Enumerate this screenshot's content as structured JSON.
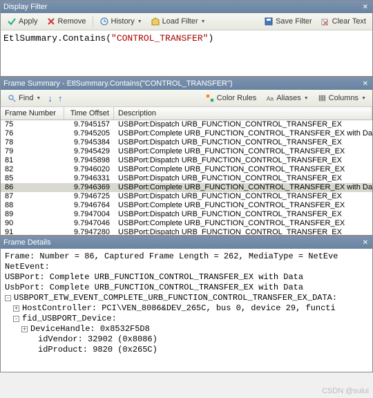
{
  "displayFilter": {
    "title": "Display Filter",
    "toolbar": {
      "apply": "Apply",
      "remove": "Remove",
      "history": "History",
      "loadFilter": "Load Filter",
      "saveFilter": "Save Filter",
      "clearText": "Clear Text"
    },
    "expression": {
      "func": "EtlSummary.Contains(",
      "str": "\"CONTROL_TRANSFER\"",
      "close": ")"
    }
  },
  "frameSummary": {
    "title": "Frame Summary - EtlSummary.Contains(\"CONTROL_TRANSFER\")",
    "toolbar": {
      "find": "Find",
      "colorRules": "Color Rules",
      "aliases": "Aliases",
      "columns": "Columns"
    },
    "columns": {
      "num": "Frame Number",
      "time": "Time Offset",
      "desc": "Description"
    },
    "rows": [
      {
        "num": "75",
        "time": "9.7945157",
        "desc": "USBPort:Dispatch URB_FUNCTION_CONTROL_TRANSFER_EX",
        "sel": false
      },
      {
        "num": "76",
        "time": "9.7945205",
        "desc": "USBPort:Complete URB_FUNCTION_CONTROL_TRANSFER_EX with Data",
        "sel": false
      },
      {
        "num": "78",
        "time": "9.7945384",
        "desc": "USBPort:Dispatch URB_FUNCTION_CONTROL_TRANSFER_EX",
        "sel": false
      },
      {
        "num": "79",
        "time": "9.7945429",
        "desc": "USBPort:Complete URB_FUNCTION_CONTROL_TRANSFER_EX",
        "sel": false
      },
      {
        "num": "81",
        "time": "9.7945898",
        "desc": "USBPort:Dispatch URB_FUNCTION_CONTROL_TRANSFER_EX",
        "sel": false
      },
      {
        "num": "82",
        "time": "9.7946020",
        "desc": "USBPort:Complete URB_FUNCTION_CONTROL_TRANSFER_EX",
        "sel": false
      },
      {
        "num": "85",
        "time": "9.7946331",
        "desc": "USBPort:Dispatch URB_FUNCTION_CONTROL_TRANSFER_EX",
        "sel": false
      },
      {
        "num": "86",
        "time": "9.7946369",
        "desc": "USBPort:Complete URB_FUNCTION_CONTROL_TRANSFER_EX with Data",
        "sel": true
      },
      {
        "num": "87",
        "time": "9.7946725",
        "desc": "USBPort:Dispatch URB_FUNCTION_CONTROL_TRANSFER_EX",
        "sel": false
      },
      {
        "num": "88",
        "time": "9.7946764",
        "desc": "USBPort:Complete URB_FUNCTION_CONTROL_TRANSFER_EX",
        "sel": false
      },
      {
        "num": "89",
        "time": "9.7947004",
        "desc": "USBPort:Dispatch URB_FUNCTION_CONTROL_TRANSFER_EX",
        "sel": false
      },
      {
        "num": "90",
        "time": "9.7947046",
        "desc": "USBPort:Complete URB_FUNCTION_CONTROL_TRANSFER_EX",
        "sel": false
      },
      {
        "num": "91",
        "time": "9.7947280",
        "desc": "USBPort:Dispatch URB_FUNCTION_CONTROL_TRANSFER_EX",
        "sel": false
      }
    ]
  },
  "frameDetails": {
    "title": "Frame Details",
    "lines": {
      "frame": "Frame: Number = 86, Captured Frame Length = 262, MediaType = NetEve",
      "netevent": "NetEvent:",
      "usbport1": "USBPort: Complete URB_FUNCTION_CONTROL_TRANSFER_EX with Data",
      "usbport2": "UsbPort: Complete URB_FUNCTION_CONTROL_TRANSFER_EX with Data",
      "etw": "USBPORT_ETW_EVENT_COMPLETE_URB_FUNCTION_CONTROL_TRANSFER_EX_DATA:",
      "host": "HostController: PCI\\VEN_8086&DEV_265C, bus 0, device 29, functi",
      "fid": "fid_USBPORT_Device:",
      "devhandle": "DeviceHandle: 0x8532F5D8",
      "idvendor": "idVendor: 32902 (0x8086)",
      "idproduct": "idProduct: 9820 (0x265C)"
    }
  },
  "watermark": "CSDN @sului"
}
